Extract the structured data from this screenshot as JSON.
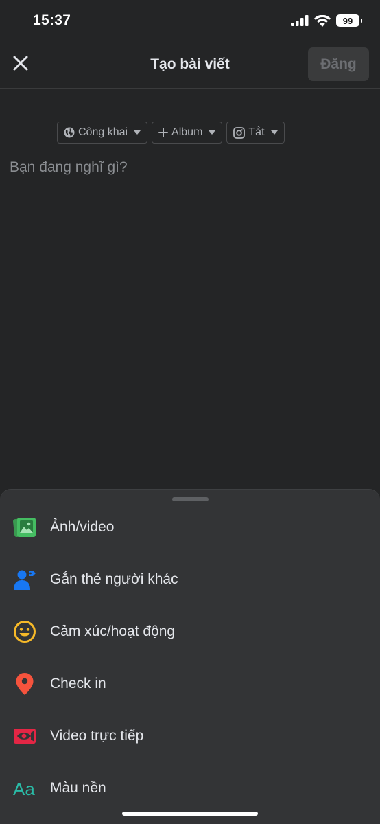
{
  "status_bar": {
    "time": "15:37",
    "battery": "99",
    "icons": [
      "cellular-signal-icon",
      "wifi-icon",
      "battery-icon"
    ]
  },
  "header": {
    "close_icon": "close-icon",
    "title": "Tạo bài viết",
    "post_label": "Đăng"
  },
  "audience": {
    "privacy": "Công khai",
    "album": "Album",
    "instagram": "Tắt"
  },
  "composer": {
    "placeholder": "Bạn đang nghĩ gì?"
  },
  "options": [
    {
      "icon": "photo-video-icon",
      "label": "Ảnh/video",
      "color": "#45bd62"
    },
    {
      "icon": "tag-people-icon",
      "label": "Gắn thẻ người khác",
      "color": "#1877f2"
    },
    {
      "icon": "feeling-icon",
      "label": "Cảm xúc/hoạt động",
      "color": "#f7b928"
    },
    {
      "icon": "check-in-icon",
      "label": "Check in",
      "color": "#f5533d"
    },
    {
      "icon": "live-video-icon",
      "label": "Video trực tiếp",
      "color": "#e42645"
    },
    {
      "icon": "background-color-icon",
      "label": "Màu nền",
      "color": "#2abba7"
    }
  ],
  "colors": {
    "background": "#242526",
    "sheet": "#333436",
    "text": "#e4e6eb",
    "muted": "#b0b3b8"
  }
}
